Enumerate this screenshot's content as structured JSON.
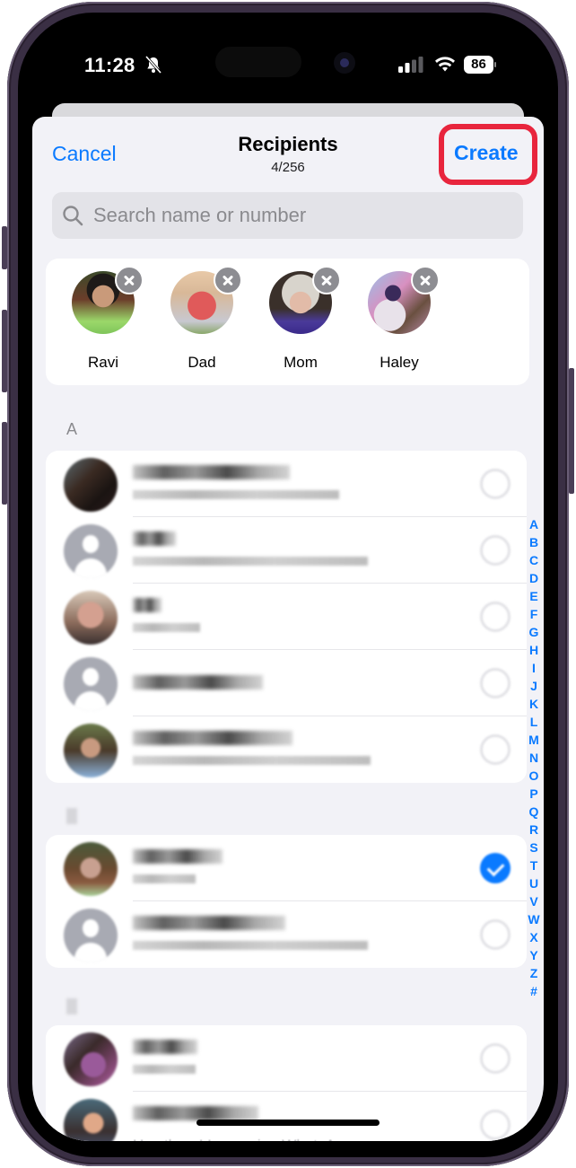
{
  "status_bar": {
    "time": "11:28",
    "silent_icon": "bell-slash-icon",
    "signal_icon": "cellular-signal-icon",
    "wifi_icon": "wifi-icon",
    "battery_percent": "86"
  },
  "nav": {
    "cancel_label": "Cancel",
    "title": "Recipients",
    "count": "4/256",
    "create_label": "Create",
    "highlight_color": "#e8253d"
  },
  "search": {
    "placeholder": "Search name or number",
    "value": ""
  },
  "selected": [
    {
      "name": "Ravi",
      "remove_icon": "close-icon"
    },
    {
      "name": "Dad",
      "remove_icon": "close-icon"
    },
    {
      "name": "Mom",
      "remove_icon": "close-icon"
    },
    {
      "name": "Haley",
      "remove_icon": "close-icon"
    }
  ],
  "sections": [
    {
      "letter": "A",
      "contacts": [
        {
          "name": "[obscured]",
          "subtitle": "[obscured]",
          "avatar": "photo",
          "selected": false
        },
        {
          "name": "[obscured]",
          "subtitle": "[obscured]",
          "avatar": "placeholder",
          "selected": false
        },
        {
          "name": "[obscured]",
          "subtitle": "[obscured]",
          "avatar": "photo",
          "selected": false
        },
        {
          "name": "[obscured]",
          "subtitle": "",
          "avatar": "placeholder",
          "selected": false
        },
        {
          "name": "[obscured]",
          "subtitle": "[obscured]",
          "avatar": "photo",
          "selected": false
        }
      ]
    },
    {
      "letter": "[obscured]",
      "contacts": [
        {
          "name": "[obscured]",
          "subtitle": "[obscured]",
          "avatar": "photo",
          "selected": true
        },
        {
          "name": "[obscured]",
          "subtitle": "[obscured]",
          "avatar": "placeholder",
          "selected": false
        }
      ]
    },
    {
      "letter": "[obscured]",
      "contacts": [
        {
          "name": "[obscured]",
          "subtitle": "[obscured]",
          "avatar": "photo",
          "selected": false
        },
        {
          "name": "[obscured]",
          "subtitle": "Hey there! I am using WhatsApp",
          "avatar": "photo",
          "selected": false
        }
      ]
    }
  ],
  "index_letters": [
    "A",
    "B",
    "C",
    "D",
    "E",
    "F",
    "G",
    "H",
    "I",
    "J",
    "K",
    "L",
    "M",
    "N",
    "O",
    "P",
    "Q",
    "R",
    "S",
    "T",
    "U",
    "V",
    "W",
    "X",
    "Y",
    "Z",
    "#"
  ],
  "colors": {
    "accent": "#0a7aff",
    "background": "#f2f2f7",
    "card": "#ffffff",
    "highlight": "#e8253d"
  }
}
